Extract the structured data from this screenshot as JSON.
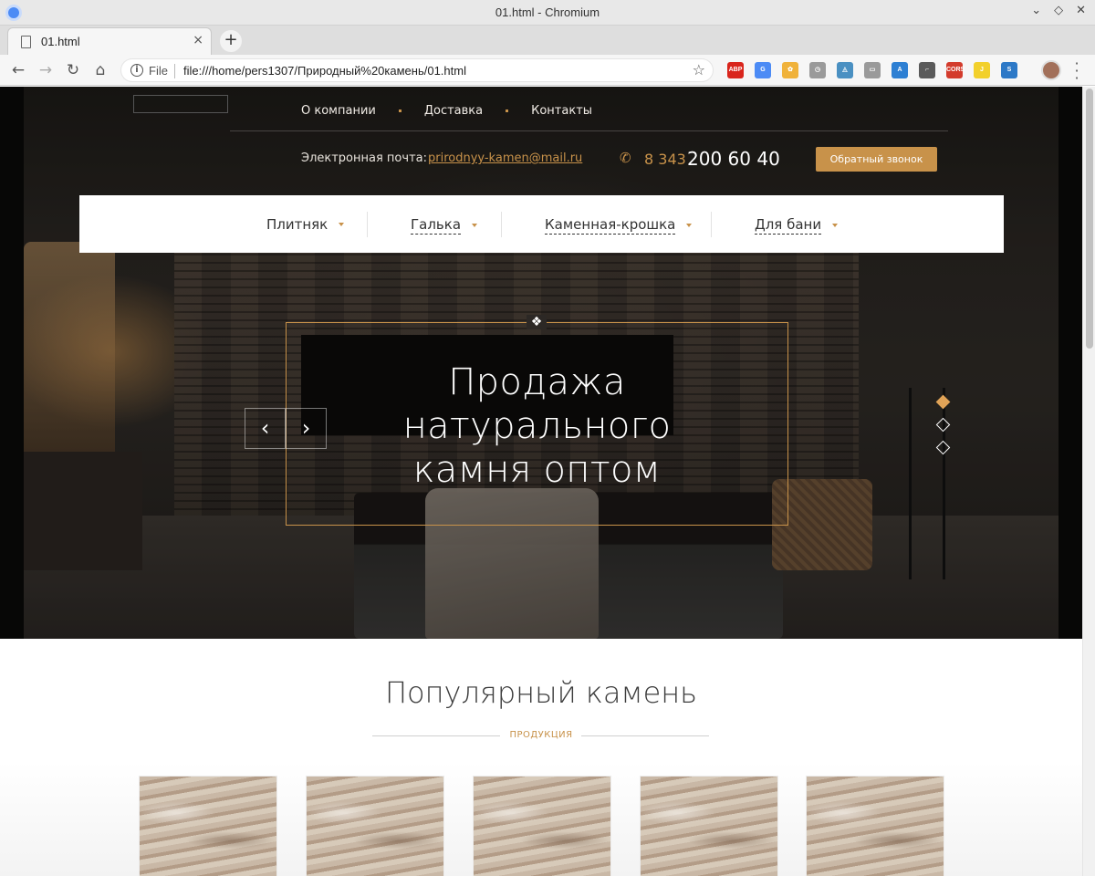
{
  "window": {
    "title": "01.html - Chromium"
  },
  "tab": {
    "title": "01.html",
    "close": "×",
    "new_tab": "+"
  },
  "toolbar": {
    "back": "←",
    "forward": "→",
    "reload": "↻",
    "home": "⌂",
    "scheme": "File",
    "url": "file:///home/pers1307/Природный%20камень/01.html",
    "star": "☆",
    "extensions": [
      {
        "name": "adblock-plus-icon",
        "text": "ABP",
        "color": "#d9251c"
      },
      {
        "name": "translate-icon",
        "text": "G",
        "color": "#4c8bf5"
      },
      {
        "name": "puzzle-icon",
        "text": "✿",
        "color": "#f0b23a"
      },
      {
        "name": "clock-icon",
        "text": "◷",
        "color": "#9a9a9a"
      },
      {
        "name": "shield-icon",
        "text": "◬",
        "color": "#4a90c2"
      },
      {
        "name": "chat-icon",
        "text": "▭",
        "color": "#9a9a9a"
      },
      {
        "name": "angular-icon",
        "text": "A",
        "color": "#2d7fd3"
      },
      {
        "name": "eyedropper-icon",
        "text": "⌐",
        "color": "#5a5a5a"
      },
      {
        "name": "cors-icon",
        "text": "CORS",
        "color": "#d33b2c"
      },
      {
        "name": "notes-icon",
        "text": "J",
        "color": "#f2d02b"
      },
      {
        "name": "s-icon",
        "text": "S",
        "color": "#2d79c7"
      }
    ]
  },
  "site": {
    "nav": [
      "О компании",
      "Доставка",
      "Контакты"
    ],
    "email_label": "Электронная почта:",
    "email": "prirodnyy-kamen@mail.ru",
    "phone_code": "8 343",
    "phone_number": "200 60 40",
    "callback": "Обратный звонок",
    "categories": [
      "Плитняк",
      "Галька",
      "Каменная-крошка",
      "Для бани"
    ],
    "slide": {
      "title_lines": [
        "Продажа",
        "натурального",
        "камня оптом"
      ],
      "prev": "‹",
      "next": "›",
      "ornament": "❖",
      "active_index": 0,
      "count": 3
    },
    "popular": {
      "title": "Популярный камень",
      "subtitle": "ПРОДУКЦИЯ"
    }
  },
  "colors": {
    "accent": "#c8924a",
    "active_dot": "#e0a357"
  }
}
